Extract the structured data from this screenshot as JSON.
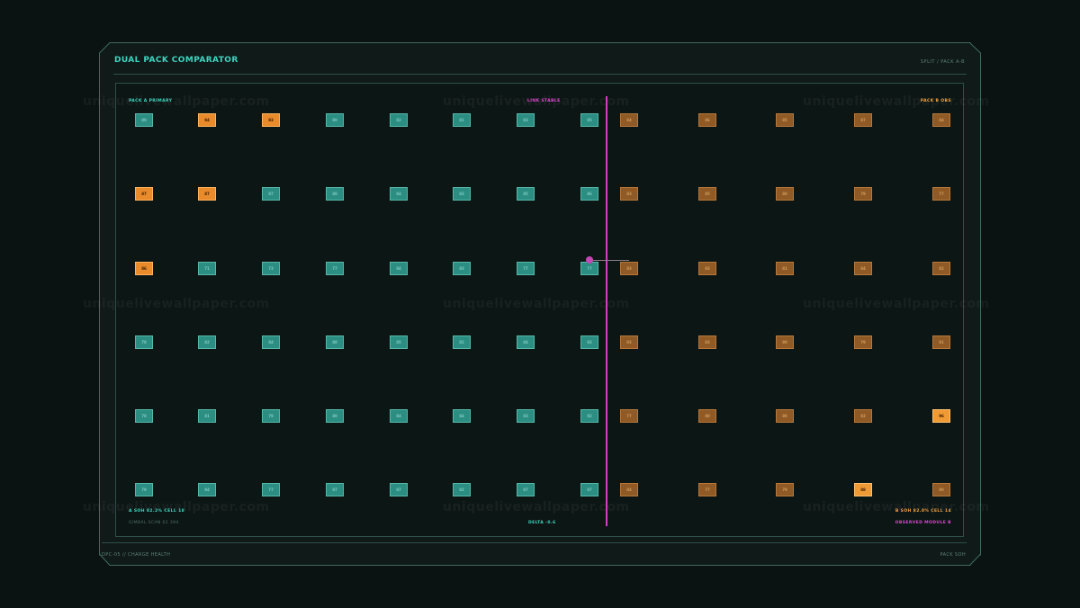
{
  "header": {
    "title": "DUAL PACK COMPARATOR",
    "right": "SPLIT / PACK A-B"
  },
  "footer": {
    "left": "DPC-05 // CHARGE HEALTH",
    "right": "PACK SOH"
  },
  "panel": {
    "pack_a_label": "PACK A PRIMARY",
    "pack_b_label": "PACK B OBS",
    "link_label": "LINK STABLE",
    "a_soh": "A SOH 82.2% CELL 18",
    "b_soh": "B SOH 82.8% CELL 14",
    "gimbal": "GIMBAL SCAN 62 394",
    "delta": "DELTA -0.6",
    "observed": "OBSERVED MODULE B"
  },
  "watermark": "uniquelivewallpaper.com",
  "colors": {
    "accent_teal": "#3ed6c0",
    "accent_orange": "#f2a03c",
    "accent_magenta": "#e048d0"
  },
  "pack_a_grid": [
    [
      {
        "v": "89",
        "t": "a"
      },
      {
        "v": "94",
        "t": "hot"
      },
      {
        "v": "93",
        "t": "hot"
      },
      {
        "v": "90",
        "t": "a"
      },
      {
        "v": "82",
        "t": "a"
      },
      {
        "v": "81",
        "t": "a"
      },
      {
        "v": "83",
        "t": "a"
      },
      {
        "v": "85",
        "t": "a"
      }
    ],
    [
      {
        "v": "87",
        "t": "hot"
      },
      {
        "v": "87",
        "t": "hot"
      },
      {
        "v": "87",
        "t": "a"
      },
      {
        "v": "88",
        "t": "a"
      },
      {
        "v": "84",
        "t": "a"
      },
      {
        "v": "83",
        "t": "a"
      },
      {
        "v": "85",
        "t": "a"
      },
      {
        "v": "86",
        "t": "a"
      }
    ],
    [
      {
        "v": "86",
        "t": "hot"
      },
      {
        "v": "71",
        "t": "a"
      },
      {
        "v": "73",
        "t": "a"
      },
      {
        "v": "77",
        "t": "a"
      },
      {
        "v": "84",
        "t": "a"
      },
      {
        "v": "83",
        "t": "a"
      },
      {
        "v": "77",
        "t": "a"
      },
      {
        "v": "77",
        "t": "a"
      }
    ],
    [
      {
        "v": "78",
        "t": "a"
      },
      {
        "v": "82",
        "t": "a"
      },
      {
        "v": "84",
        "t": "a"
      },
      {
        "v": "88",
        "t": "a"
      },
      {
        "v": "85",
        "t": "a"
      },
      {
        "v": "82",
        "t": "a"
      },
      {
        "v": "84",
        "t": "a"
      },
      {
        "v": "83",
        "t": "a"
      }
    ],
    [
      {
        "v": "78",
        "t": "a"
      },
      {
        "v": "81",
        "t": "a"
      },
      {
        "v": "79",
        "t": "a"
      },
      {
        "v": "80",
        "t": "a"
      },
      {
        "v": "84",
        "t": "a"
      },
      {
        "v": "84",
        "t": "a"
      },
      {
        "v": "83",
        "t": "a"
      },
      {
        "v": "82",
        "t": "a"
      }
    ],
    [
      {
        "v": "79",
        "t": "a"
      },
      {
        "v": "84",
        "t": "a"
      },
      {
        "v": "77",
        "t": "a"
      },
      {
        "v": "87",
        "t": "a"
      },
      {
        "v": "87",
        "t": "a"
      },
      {
        "v": "82",
        "t": "a"
      },
      {
        "v": "87",
        "t": "a"
      },
      {
        "v": "87",
        "t": "a"
      }
    ]
  ],
  "pack_b_grid": [
    [
      {
        "v": "84",
        "t": "b"
      },
      {
        "v": "86",
        "t": "b"
      },
      {
        "v": "85",
        "t": "b"
      },
      {
        "v": "87",
        "t": "b"
      },
      {
        "v": "84",
        "t": "b"
      }
    ],
    [
      {
        "v": "83",
        "t": "b"
      },
      {
        "v": "85",
        "t": "b"
      },
      {
        "v": "80",
        "t": "b"
      },
      {
        "v": "79",
        "t": "b"
      },
      {
        "v": "77",
        "t": "b"
      }
    ],
    [
      {
        "v": "83",
        "t": "b"
      },
      {
        "v": "83",
        "t": "b"
      },
      {
        "v": "81",
        "t": "b"
      },
      {
        "v": "84",
        "t": "b"
      },
      {
        "v": "82",
        "t": "b"
      }
    ],
    [
      {
        "v": "83",
        "t": "b"
      },
      {
        "v": "83",
        "t": "b"
      },
      {
        "v": "80",
        "t": "b"
      },
      {
        "v": "79",
        "t": "b"
      },
      {
        "v": "81",
        "t": "b"
      }
    ],
    [
      {
        "v": "77",
        "t": "b"
      },
      {
        "v": "80",
        "t": "b"
      },
      {
        "v": "80",
        "t": "b"
      },
      {
        "v": "82",
        "t": "b"
      },
      {
        "v": "96",
        "t": "hot"
      }
    ],
    [
      {
        "v": "84",
        "t": "b"
      },
      {
        "v": "77",
        "t": "b"
      },
      {
        "v": "79",
        "t": "b"
      },
      {
        "v": "88",
        "t": "hot"
      },
      {
        "v": "80",
        "t": "b"
      }
    ]
  ]
}
